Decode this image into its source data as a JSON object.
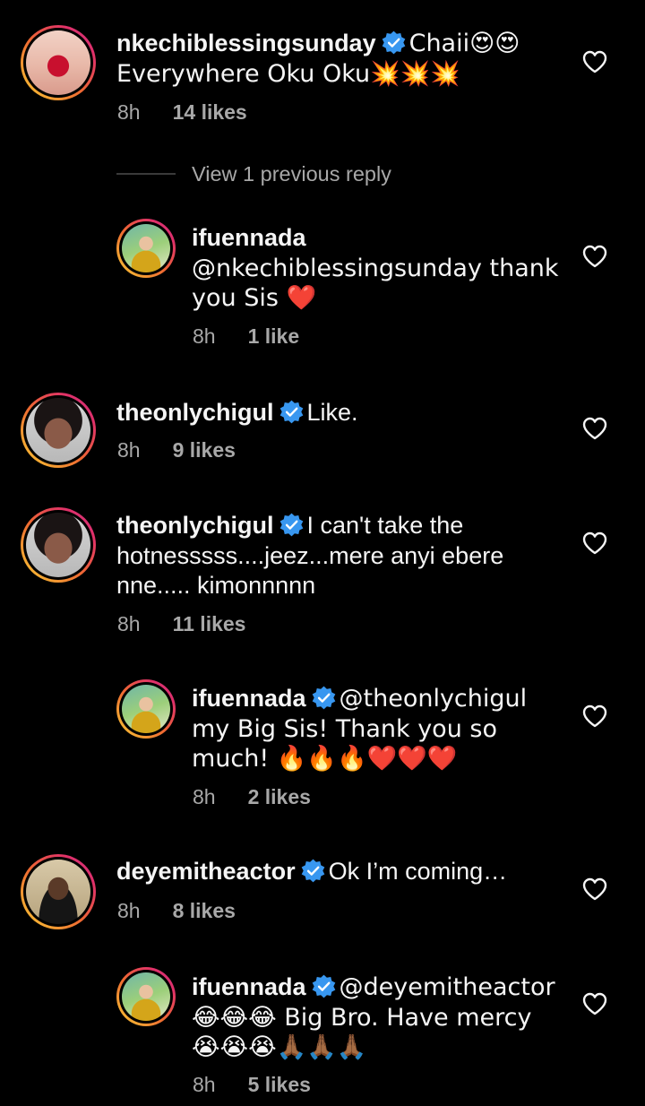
{
  "comments": [
    {
      "username": "nkechiblessingsunday",
      "verified": true,
      "text": "Chaii😍😍 Everywhere Oku Oku💥💥💥",
      "time": "8h",
      "likes": "14 likes"
    },
    {
      "username": "theonlychigul",
      "verified": true,
      "text": "Like.",
      "time": "8h",
      "likes": "9 likes"
    },
    {
      "username": "theonlychigul",
      "verified": true,
      "text": "I can't take the hotnesssss....jeez...mere anyi ebere nne..... kimonnnnn",
      "time": "8h",
      "likes": "11 likes"
    },
    {
      "username": "deyemitheactor",
      "verified": true,
      "text": "Ok I’m coming…",
      "time": "8h",
      "likes": "8 likes"
    }
  ],
  "view_replies_label": "View 1 previous reply",
  "replies": [
    {
      "username": "ifuennada",
      "verified": false,
      "text": "@nkechiblessingsunday thank you Sis ❤️",
      "time": "8h",
      "likes": "1 like"
    },
    {
      "username": "ifuennada",
      "verified": true,
      "text": "@theonlychigul my Big Sis! Thank you so much! 🔥🔥🔥❤️❤️❤️",
      "time": "8h",
      "likes": "2 likes"
    },
    {
      "username": "ifuennada",
      "verified": true,
      "text": "@deyemitheactor 😂😂😂 Big Bro. Have mercy 😭😭😭🙏🏾🙏🏾🙏🏾",
      "time": "8h",
      "likes": "5 likes"
    }
  ],
  "icons": {
    "verified": "verified-badge-icon",
    "like": "heart-outline-icon"
  },
  "colors": {
    "background": "#000000",
    "text": "#f5f5f5",
    "meta": "#a8a8a8",
    "verified": "#3897f0"
  }
}
